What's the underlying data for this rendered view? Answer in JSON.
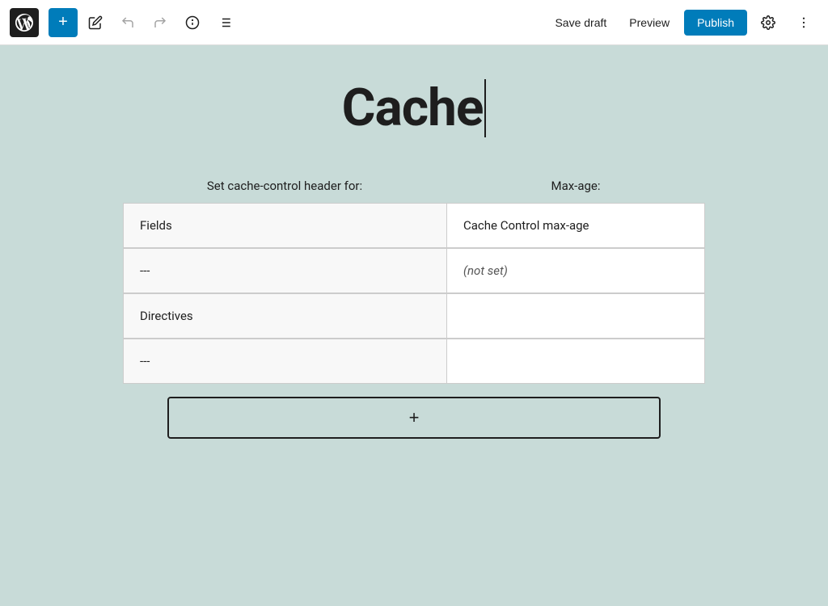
{
  "toolbar": {
    "add_label": "+",
    "save_draft_label": "Save draft",
    "preview_label": "Preview",
    "publish_label": "Publish"
  },
  "page": {
    "title": "Cache"
  },
  "table": {
    "left_header": "Set cache-control header for:",
    "right_header": "Max-age:",
    "rows": [
      {
        "left": "Fields",
        "right": "Cache Control max-age",
        "right_italic": false
      },
      {
        "left": "---",
        "right": "(not set)",
        "right_italic": true
      },
      {
        "left": "Directives",
        "right": "",
        "right_italic": false
      },
      {
        "left": "---",
        "right": "",
        "right_italic": false
      }
    ]
  },
  "add_row_label": "+"
}
